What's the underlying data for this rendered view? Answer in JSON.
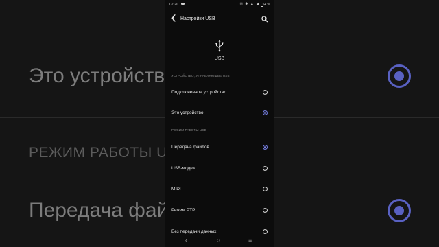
{
  "background": {
    "item_label": "Это устройство",
    "section_label": "РЕЖИМ РАБОТЫ USB",
    "mode_label": "Передача файлов",
    "accent": "#5961c2"
  },
  "status_bar": {
    "time": "02:20",
    "icons": "✉ ✱ ▲ ◢",
    "battery": "54 %"
  },
  "app_bar": {
    "back_icon": "back-arrow-icon",
    "title": "Настройки USB",
    "search_icon": "search-icon"
  },
  "header": {
    "icon": "usb-icon",
    "label": "USB"
  },
  "sections": [
    {
      "title": "УСТРОЙСТВО, УПРАВЛЯЮЩЕЕ USB",
      "items": [
        {
          "label": "Подключенное устройство",
          "selected": false
        },
        {
          "label": "Это устройство",
          "selected": true
        }
      ]
    },
    {
      "title": "РЕЖИМ РАБОТЫ USB",
      "items": [
        {
          "label": "Передача файлов",
          "selected": true
        },
        {
          "label": "USB-модем",
          "selected": false
        },
        {
          "label": "MIDI",
          "selected": false
        },
        {
          "label": "Режим PTP",
          "selected": false
        },
        {
          "label": "Без передачи данных",
          "selected": false
        }
      ]
    }
  ],
  "nav_bar": {
    "back": "‹",
    "home": "○",
    "recents": "≡"
  },
  "colors": {
    "accent": "#7a83ea",
    "background": "#0c0c0c"
  }
}
